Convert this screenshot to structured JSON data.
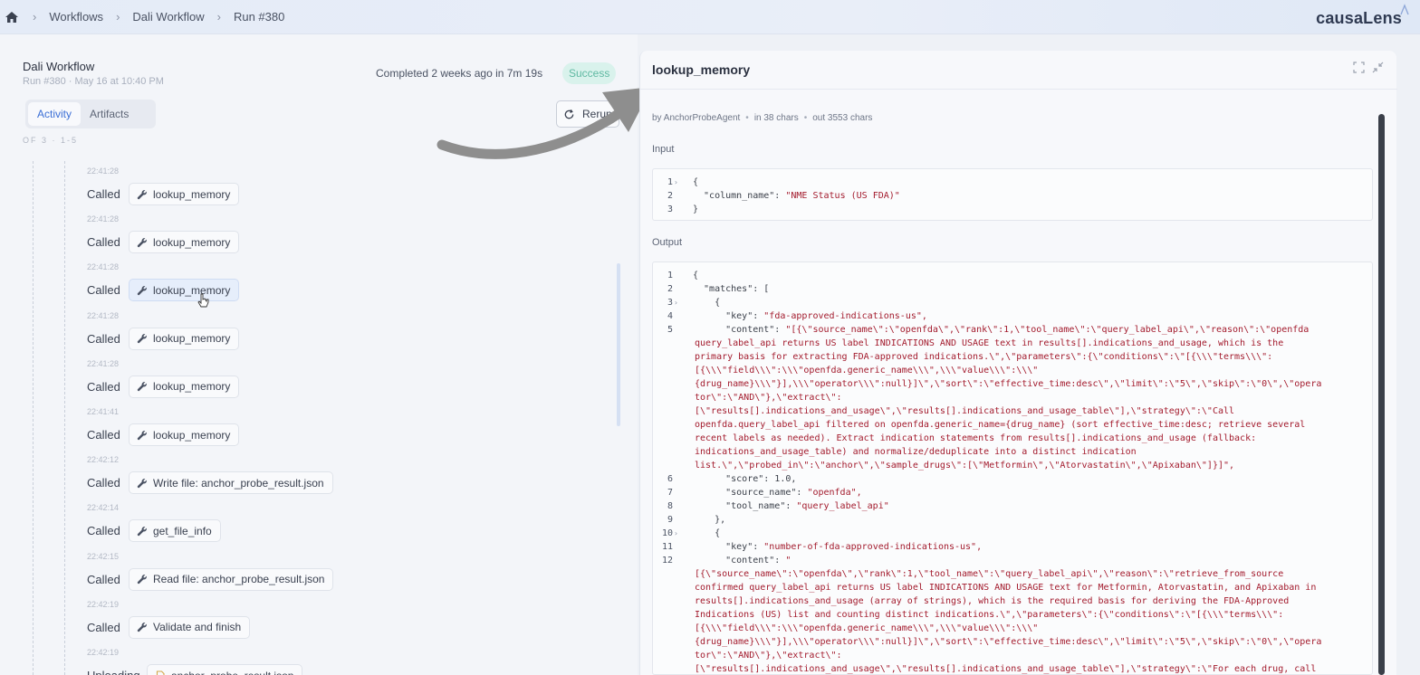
{
  "breadcrumb": [
    "Workflows",
    "Dali Workflow",
    "Run #380"
  ],
  "brand": "causaLens",
  "run": {
    "title": "Dali Workflow",
    "subtitle": "Run #380 · May 16 at 10:40 PM",
    "completed": "Completed 2 weeks ago in 7m 19s",
    "status": "Success"
  },
  "tabs": [
    "Activity",
    "Artifacts"
  ],
  "rerun_label": "Rerun",
  "clipped_text": "OF 3 · 1-5",
  "events": [
    {
      "time": "22:41:28",
      "action": "Called",
      "tool": "lookup_memory"
    },
    {
      "time": "22:41:28",
      "action": "Called",
      "tool": "lookup_memory"
    },
    {
      "time": "22:41:28",
      "action": "Called",
      "tool": "lookup_memory"
    },
    {
      "time": "22:41:28",
      "action": "Called",
      "tool": "lookup_memory"
    },
    {
      "time": "22:41:28",
      "action": "Called",
      "tool": "lookup_memory"
    },
    {
      "time": "22:41:41",
      "action": "Called",
      "tool": "lookup_memory"
    },
    {
      "time": "22:42:12",
      "action": "Called",
      "tool": "Write file: anchor_probe_result.json"
    },
    {
      "time": "22:42:14",
      "action": "Called",
      "tool": "get_file_info"
    },
    {
      "time": "22:42:15",
      "action": "Called",
      "tool": "Read file: anchor_probe_result.json"
    },
    {
      "time": "22:42:19",
      "action": "Called",
      "tool": "Validate and finish"
    },
    {
      "time": "22:42:19",
      "action": "Uploading",
      "tool": "anchor_probe_result.json"
    }
  ],
  "detail": {
    "title": "lookup_memory",
    "meta_agent": "by AnchorProbeAgent",
    "meta_in": "in 38 chars",
    "meta_out": "out 3553 chars",
    "input_label": "Input",
    "output_label": "Output",
    "input_lines": [
      {
        "n": "1",
        "fold": true,
        "k": "{",
        "v": ""
      },
      {
        "n": "2",
        "fold": false,
        "k": "  \"column_name\": ",
        "v": "\"NME Status (US FDA)\""
      },
      {
        "n": "3",
        "fold": false,
        "k": "}",
        "v": ""
      }
    ],
    "output_lines": [
      {
        "n": "1",
        "fold": false,
        "k": "{",
        "v": "",
        "cont": []
      },
      {
        "n": "2",
        "fold": false,
        "k": "  \"matches\": [",
        "v": "",
        "cont": []
      },
      {
        "n": "3",
        "fold": true,
        "k": "    {",
        "v": "",
        "cont": []
      },
      {
        "n": "4",
        "fold": false,
        "k": "      \"key\": ",
        "v": "\"fda-approved-indications-us\",",
        "cont": []
      },
      {
        "n": "5",
        "fold": false,
        "k": "      \"content\": ",
        "v": "\"[{\\\"source_name\\\":\\\"openfda\\\",\\\"rank\\\":1,\\\"tool_name\\\":\\\"query_label_api\\\",\\\"reason\\\":\\\"openfda",
        "cont": [
          "query_label_api returns US label INDICATIONS AND USAGE text in results[].indications_and_usage, which is the",
          "primary basis for extracting FDA-approved indications.\\\",\\\"parameters\\\":{\\\"conditions\\\":\\\"[{\\\\\\\"terms\\\\\\\":",
          "[{\\\\\\\"field\\\\\\\":\\\\\\\"openfda.generic_name\\\\\\\",\\\\\\\"value\\\\\\\":\\\\\\\"",
          "{drug_name}\\\\\\\"}],\\\\\\\"operator\\\\\\\":null}]\\\",\\\"sort\\\":\\\"effective_time:desc\\\",\\\"limit\\\":\\\"5\\\",\\\"skip\\\":\\\"0\\\",\\\"opera",
          "tor\\\":\\\"AND\\\"},\\\"extract\\\":",
          "[\\\"results[].indications_and_usage\\\",\\\"results[].indications_and_usage_table\\\"],\\\"strategy\\\":\\\"Call",
          "openfda.query_label_api filtered on openfda.generic_name={drug_name} (sort effective_time:desc; retrieve several",
          "recent labels as needed). Extract indication statements from results[].indications_and_usage (fallback:",
          "indications_and_usage_table) and normalize/deduplicate into a distinct indication",
          "list.\\\",\\\"probed_in\\\":\\\"anchor\\\",\\\"sample_drugs\\\":[\\\"Metformin\\\",\\\"Atorvastatin\\\",\\\"Apixaban\\\"]}]\","
        ]
      },
      {
        "n": "6",
        "fold": false,
        "k": "      \"score\": 1.0,",
        "v": "",
        "cont": []
      },
      {
        "n": "7",
        "fold": false,
        "k": "      \"source_name\": ",
        "v": "\"openfda\",",
        "cont": []
      },
      {
        "n": "8",
        "fold": false,
        "k": "      \"tool_name\": ",
        "v": "\"query_label_api\"",
        "cont": []
      },
      {
        "n": "9",
        "fold": false,
        "k": "    },",
        "v": "",
        "cont": []
      },
      {
        "n": "10",
        "fold": true,
        "k": "    {",
        "v": "",
        "cont": []
      },
      {
        "n": "11",
        "fold": false,
        "k": "      \"key\": ",
        "v": "\"number-of-fda-approved-indications-us\",",
        "cont": []
      },
      {
        "n": "12",
        "fold": false,
        "k": "      \"content\": ",
        "v": "\"",
        "cont": [
          "[{\\\"source_name\\\":\\\"openfda\\\",\\\"rank\\\":1,\\\"tool_name\\\":\\\"query_label_api\\\",\\\"reason\\\":\\\"retrieve_from_source",
          "confirmed query_label_api returns US label INDICATIONS AND USAGE text for Metformin, Atorvastatin, and Apixaban in",
          "results[].indications_and_usage (array of strings), which is the required basis for deriving the FDA-Approved",
          "Indications (US) list and counting distinct indications.\\\",\\\"parameters\\\":{\\\"conditions\\\":\\\"[{\\\\\\\"terms\\\\\\\":",
          "[{\\\\\\\"field\\\\\\\":\\\\\\\"openfda.generic_name\\\\\\\",\\\\\\\"value\\\\\\\":\\\\\\\"",
          "{drug_name}\\\\\\\"}],\\\\\\\"operator\\\\\\\":null}]\\\",\\\"sort\\\":\\\"effective_time:desc\\\",\\\"limit\\\":\\\"5\\\",\\\"skip\\\":\\\"0\\\",\\\"opera",
          "tor\\\":\\\"AND\\\"},\\\"extract\\\":",
          "[\\\"results[].indications_and_usage\\\",\\\"results[].indications_and_usage_table\\\"],\\\"strategy\\\":\\\"For each drug, call"
        ]
      }
    ]
  },
  "colors": {
    "accent": "#3b6fd6",
    "success_bg": "#d9f2ec",
    "success_fg": "#5fb9a2",
    "string": "#a31b2d"
  }
}
